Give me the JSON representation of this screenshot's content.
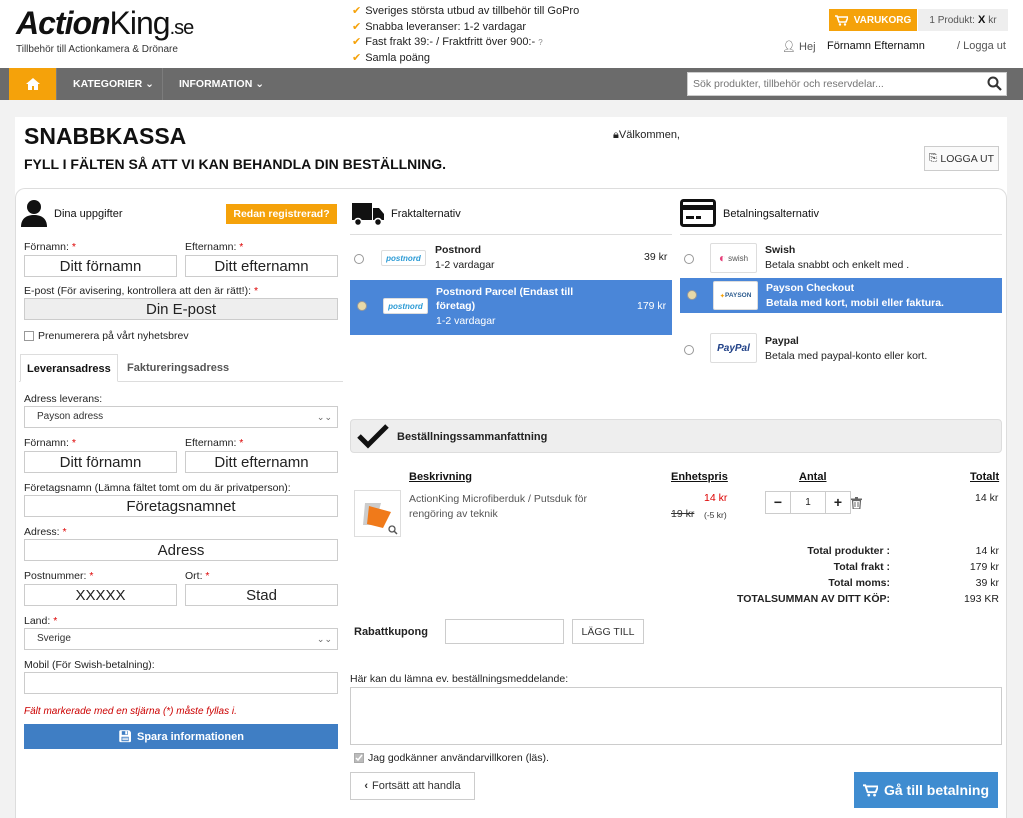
{
  "header": {
    "logo_bold": "Action",
    "logo_regular": "King",
    "logo_tld": ".se",
    "logo_tagline": "Tillbehör till Actionkamera & Drönare",
    "usps": [
      "Sveriges största utbud av tillbehör till GoPro",
      "Snabba leveranser: 1-2 vardagar",
      "Fast frakt 39:- / Fraktfritt över 900:-",
      "Samla poäng"
    ],
    "usp_info": "?",
    "cart_label": "VARUKORG",
    "cart_count": "1 Produkt:",
    "cart_x": "X",
    "cart_currency": "kr",
    "greeting": "Hej",
    "user_name": "Förnamn Efternamn",
    "logout_link": "/ Logga ut"
  },
  "nav": {
    "items": [
      {
        "label": "KATEGORIER"
      },
      {
        "label": "INFORMATION"
      }
    ],
    "search_placeholder": "Sök produkter, tillbehör och reservdelar..."
  },
  "page": {
    "title": "SNABBKASSA",
    "subtitle": "FYLL I FÄLTEN SÅ ATT VI KAN BEHANDLA DIN BESTÄLLNING.",
    "welcome": "Välkommen,",
    "logout_button": "LOGGA UT"
  },
  "customer": {
    "heading": "Dina uppgifter",
    "registered_badge": "Redan registrerad?",
    "firstname_label": "Förnamn:",
    "firstname_value": "Ditt förnamn",
    "lastname_label": "Efternamn:",
    "lastname_value": "Ditt efternamn",
    "email_label": "E-post (För avisering, kontrollera att den är rätt!):",
    "email_value": "Din E-post",
    "newsletter_label": "Prenumerera på vårt nyhetsbrev",
    "tabs": [
      "Leveransadress",
      "Faktureringsadress"
    ],
    "address_select_label": "Adress leverans:",
    "address_select_value": "Payson adress",
    "d_firstname_label": "Förnamn:",
    "d_firstname_value": "Ditt förnamn",
    "d_lastname_label": "Efternamn:",
    "d_lastname_value": "Ditt efternamn",
    "company_label": "Företagsnamn (Lämna fältet tomt om du är privatperson):",
    "company_value": "Företagsnamnet",
    "address_label": "Adress:",
    "address_value": "Adress",
    "postal_label": "Postnummer:",
    "postal_value": "XXXXX",
    "city_label": "Ort:",
    "city_value": "Stad",
    "country_label": "Land:",
    "country_value": "Sverige",
    "mobile_label": "Mobil (För Swish-betalning):",
    "mobile_value": "",
    "required_note": "Fält markerade med en stjärna (*) måste fyllas i.",
    "save_button": "Spara informationen",
    "required_star": "*"
  },
  "shipping": {
    "heading": "Fraktalternativ",
    "options": [
      {
        "logo": "postnord",
        "name": "Postnord",
        "desc": "1-2 vardagar",
        "price": "39 kr",
        "selected": false
      },
      {
        "logo": "postnord",
        "name": "Postnord Parcel (Endast till företag)",
        "desc": "1-2 vardagar",
        "price": "179 kr",
        "selected": true
      }
    ]
  },
  "payment": {
    "heading": "Betalningsalternativ",
    "options": [
      {
        "logo": "swish",
        "name": "Swish",
        "desc": "Betala snabbt och enkelt med .",
        "selected": false
      },
      {
        "logo": "PAYSON",
        "name": "Payson Checkout",
        "desc": "Betala med kort, mobil eller faktura.",
        "selected": true
      },
      {
        "logo": "PayPal",
        "name": "Paypal",
        "desc": "Betala med paypal-konto eller kort.",
        "selected": false
      }
    ]
  },
  "summary": {
    "heading": "Beställningssammanfattning",
    "col_desc": "Beskrivning",
    "col_unit": "Enhetspris",
    "col_qty": "Antal",
    "col_total": "Totalt",
    "item": {
      "name": "ActionKing Microfiberduk / Putsduk för rengöring av teknik",
      "price": "14 kr",
      "old_price": "19 kr",
      "discount": "(-5 kr)",
      "qty": "1",
      "total": "14 kr"
    },
    "totals": [
      {
        "label": "Total produkter :",
        "value": "14 kr"
      },
      {
        "label": "Total frakt :",
        "value": "179 kr"
      },
      {
        "label": "Total moms:",
        "value": "39 kr"
      },
      {
        "label": "TOTALSUMMAN AV DITT KÖP:",
        "value": "193 KR"
      }
    ],
    "coupon_label": "Rabattkupong",
    "coupon_value": "",
    "coupon_button": "LÄGG TILL",
    "message_label": "Här kan du lämna ev. beställningsmeddelande:",
    "terms_label": "Jag godkänner användarvillkoren (läs).",
    "continue_button": "Fortsätt att handla",
    "checkout_button": "Gå till betalning"
  },
  "colors": {
    "accent": "#f5a20a",
    "nav": "#6b6b6b",
    "selected": "#4a86d8",
    "button_blue": "#3f7ec4",
    "price_red": "#d00000"
  }
}
